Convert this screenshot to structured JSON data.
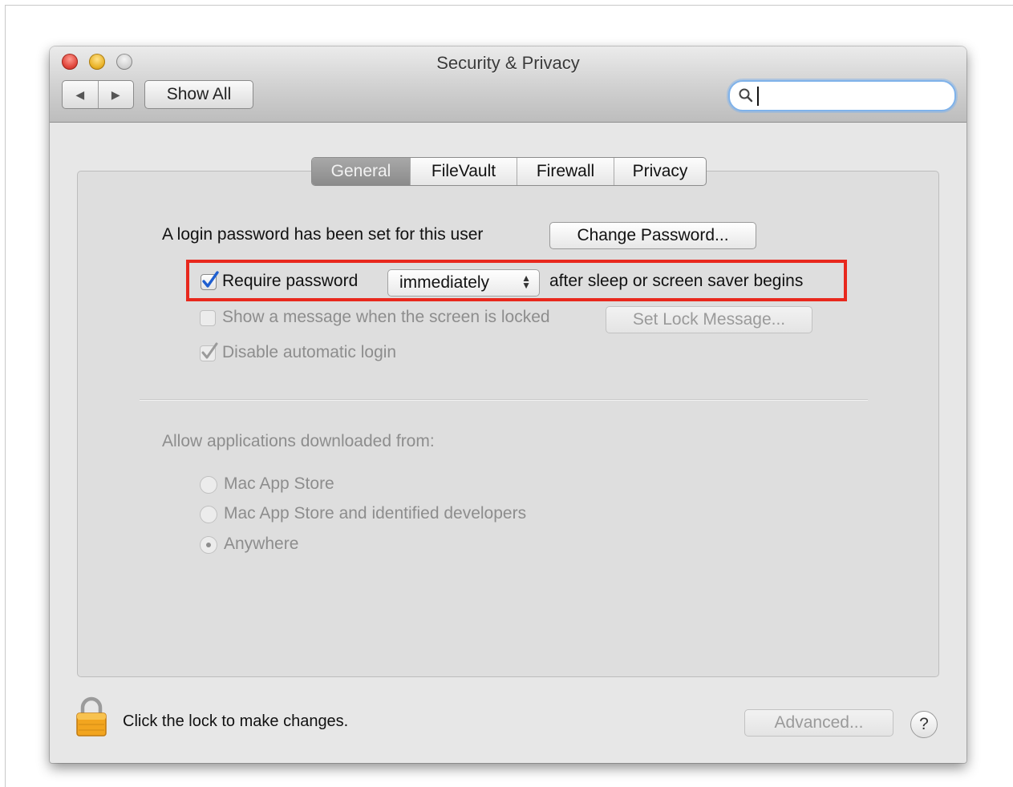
{
  "window": {
    "title": "Security & Privacy"
  },
  "toolbar": {
    "back_icon": "◀",
    "forward_icon": "▶",
    "show_all_label": "Show All"
  },
  "search": {
    "value": "",
    "placeholder": ""
  },
  "tabs": [
    {
      "label": "General",
      "active": true
    },
    {
      "label": "FileVault",
      "active": false
    },
    {
      "label": "Firewall",
      "active": false
    },
    {
      "label": "Privacy",
      "active": false
    }
  ],
  "general": {
    "login_text": "A login password has been set for this user",
    "change_password_label": "Change Password...",
    "require_password": {
      "label": "Require password",
      "checked": true,
      "select_value": "immediately",
      "suffix": "after sleep or screen saver begins"
    },
    "show_message": {
      "label": "Show a message when the screen is locked",
      "checked": false,
      "button_label": "Set Lock Message..."
    },
    "disable_autologin": {
      "label": "Disable automatic login",
      "checked": true
    },
    "allow_apps_heading": "Allow applications downloaded from:",
    "allow_apps_options": [
      {
        "label": "Mac App Store",
        "selected": false
      },
      {
        "label": "Mac App Store and identified developers",
        "selected": false
      },
      {
        "label": "Anywhere",
        "selected": true
      }
    ]
  },
  "footer": {
    "lock_text": "Click the lock to make changes.",
    "advanced_label": "Advanced...",
    "help_label": "?"
  },
  "colors": {
    "highlight": "#e8281d",
    "search_focus": "#7fb2ea",
    "active_tab": "#9a9a9a"
  },
  "icons": {
    "lock": "lock-icon",
    "search": "search-icon",
    "help": "help-icon"
  }
}
